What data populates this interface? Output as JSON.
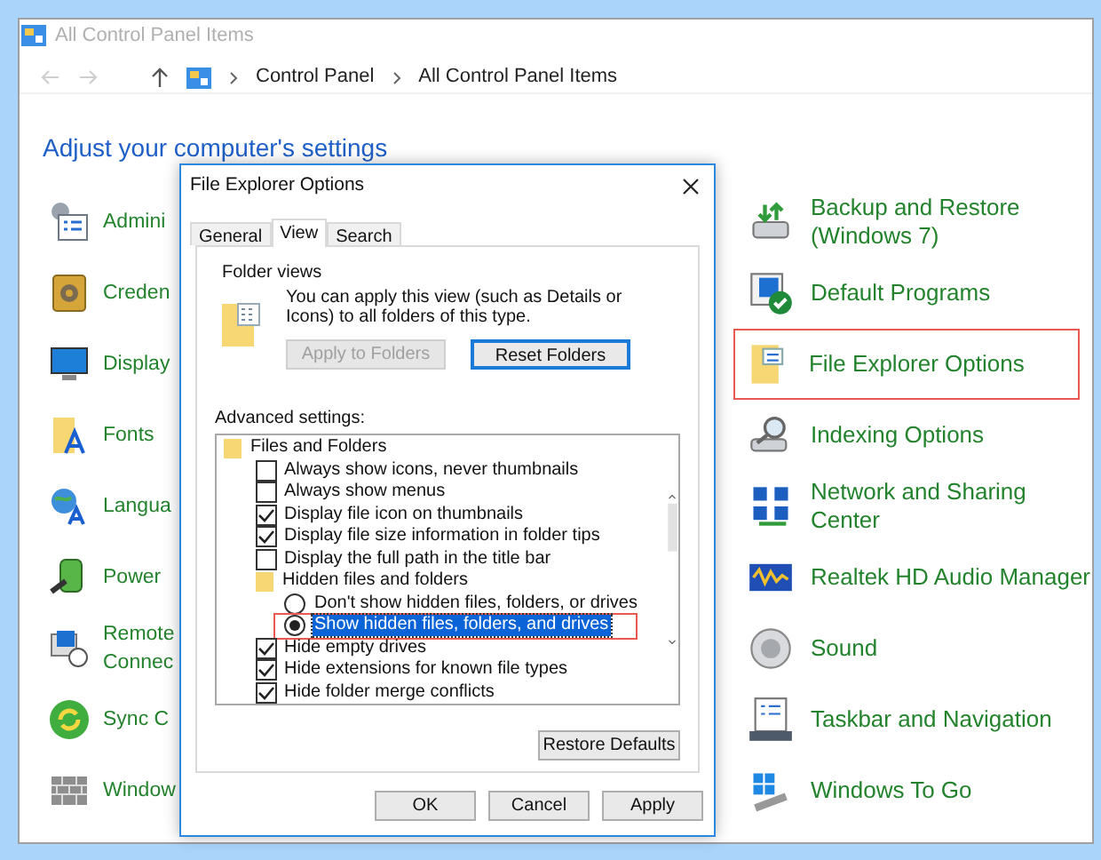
{
  "window": {
    "title": "All Control Panel Items"
  },
  "nav": {
    "back_disabled": true,
    "forward_disabled": true,
    "breadcrumb": [
      "Control Panel",
      "All Control Panel Items"
    ]
  },
  "heading": "Adjust your computer's settings",
  "left_items": [
    {
      "lines": [
        "Admini"
      ]
    },
    {
      "lines": [
        "Creden"
      ]
    },
    {
      "lines": [
        "Display"
      ]
    },
    {
      "lines": [
        "Fonts"
      ]
    },
    {
      "lines": [
        "Langua"
      ]
    },
    {
      "lines": [
        "Power"
      ]
    },
    {
      "lines": [
        "Remote",
        "Connec"
      ]
    },
    {
      "lines": [
        "Sync C"
      ]
    },
    {
      "lines": [
        "Window"
      ]
    }
  ],
  "right_items": [
    {
      "lines": [
        "Backup and Restore",
        "(Windows 7)"
      ],
      "highlighted": false
    },
    {
      "lines": [
        "Default Programs"
      ],
      "highlighted": false
    },
    {
      "lines": [
        "File Explorer Options"
      ],
      "highlighted": true
    },
    {
      "lines": [
        "Indexing Options"
      ],
      "highlighted": false
    },
    {
      "lines": [
        "Network and Sharing",
        "Center"
      ],
      "highlighted": false
    },
    {
      "lines": [
        "Realtek HD Audio Manager"
      ],
      "highlighted": false
    },
    {
      "lines": [
        "Sound"
      ],
      "highlighted": false
    },
    {
      "lines": [
        "Taskbar and Navigation"
      ],
      "highlighted": false
    },
    {
      "lines": [
        "Windows To Go"
      ],
      "highlighted": false
    }
  ],
  "dialog": {
    "title": "File Explorer Options",
    "tabs": [
      {
        "label": "General",
        "selected": false
      },
      {
        "label": "View",
        "selected": true
      },
      {
        "label": "Search",
        "selected": false
      }
    ],
    "folder_views": {
      "label": "Folder views",
      "text": "You can apply this view (such as Details or Icons) to all folders of this type.",
      "buttons": [
        {
          "label": "Apply to Folders",
          "disabled": true
        },
        {
          "label": "Reset Folders",
          "disabled": false
        }
      ]
    },
    "advanced_label": "Advanced settings:",
    "tree": [
      {
        "kind": "folder",
        "label": "Files and Folders",
        "children": [
          {
            "kind": "checkbox",
            "label": "Always show icons, never thumbnails",
            "checked": false
          },
          {
            "kind": "checkbox",
            "label": "Always show menus",
            "checked": false
          },
          {
            "kind": "checkbox",
            "label": "Display file icon on thumbnails",
            "checked": true
          },
          {
            "kind": "checkbox",
            "label": "Display file size information in folder tips",
            "checked": true
          },
          {
            "kind": "checkbox",
            "label": "Display the full path in the title bar",
            "checked": false
          },
          {
            "kind": "folder",
            "label": "Hidden files and folders",
            "children": [
              {
                "kind": "radio",
                "label": "Don't show hidden files, folders, or drives",
                "checked": false,
                "focused": false,
                "highlighted": false
              },
              {
                "kind": "radio",
                "label": "Show hidden files, folders, and drives",
                "checked": true,
                "focused": true,
                "highlighted": true
              }
            ]
          },
          {
            "kind": "checkbox",
            "label": "Hide empty drives",
            "checked": true
          },
          {
            "kind": "checkbox",
            "label": "Hide extensions for known file types",
            "checked": true
          },
          {
            "kind": "checkbox",
            "label": "Hide folder merge conflicts",
            "checked": true
          }
        ]
      }
    ],
    "restore_button": "Restore Defaults",
    "buttons": [
      "OK",
      "Cancel",
      "Apply"
    ]
  }
}
